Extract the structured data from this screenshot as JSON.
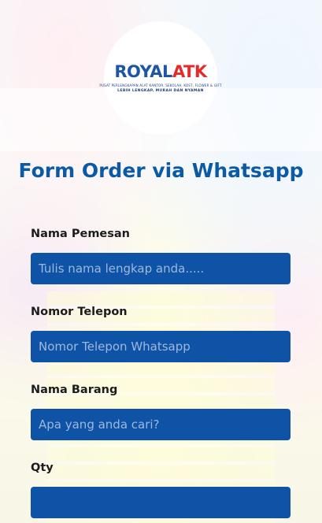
{
  "logo": {
    "brand_part1": "ROYAL",
    "brand_part2": "ATK",
    "tagline": "PUSAT PERLENGKAPAN ALAT KANTOR, SEKOLAH, KOST, FLOWER & GIFT",
    "slogan": "LEBIH LENGKAP, MURAH DAN NYAMAN",
    "colors": {
      "royal": "#1e55a5",
      "atk": "#e32b2b"
    }
  },
  "form": {
    "title": "Form Order via Whatsapp",
    "fields": [
      {
        "label": "Nama Pemesan",
        "placeholder": "Tulis nama lengkap anda.....",
        "value": ""
      },
      {
        "label": "Nomor Telepon",
        "placeholder": "Nomor Telepon Whatsapp",
        "value": ""
      },
      {
        "label": "Nama Barang",
        "placeholder": "Apa yang anda cari?",
        "value": ""
      },
      {
        "label": "Qty",
        "placeholder": "",
        "value": ""
      }
    ],
    "colors": {
      "title": "#0b5aa6",
      "input_bg": "#0e53a6"
    }
  }
}
